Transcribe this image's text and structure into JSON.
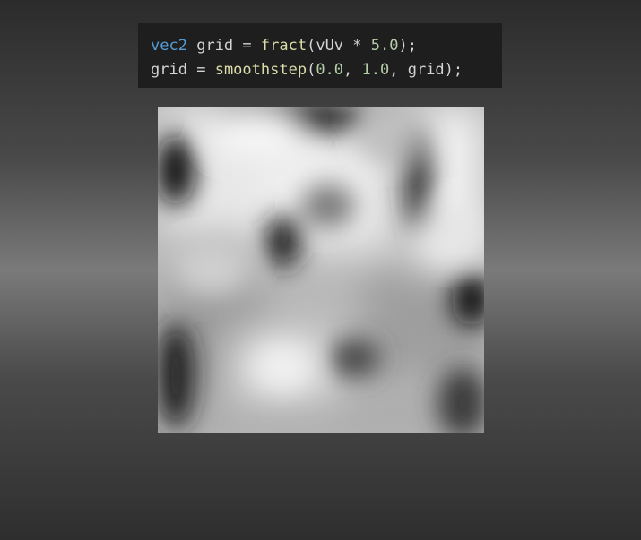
{
  "code": {
    "line1": {
      "type": "vec2",
      "var": "grid",
      "eq": "=",
      "fn": "fract",
      "open": "(vUv * ",
      "num": "5.0",
      "close": ");"
    },
    "line2": {
      "var": "grid",
      "eq": "=",
      "fn": "smoothstep",
      "open": "(",
      "a": "0.0",
      "sep1": ", ",
      "b": "1.0",
      "sep2": ", ",
      "arg": "grid",
      "close": ");"
    }
  },
  "preview": {
    "description_icon": "shader-preview-canvas"
  }
}
